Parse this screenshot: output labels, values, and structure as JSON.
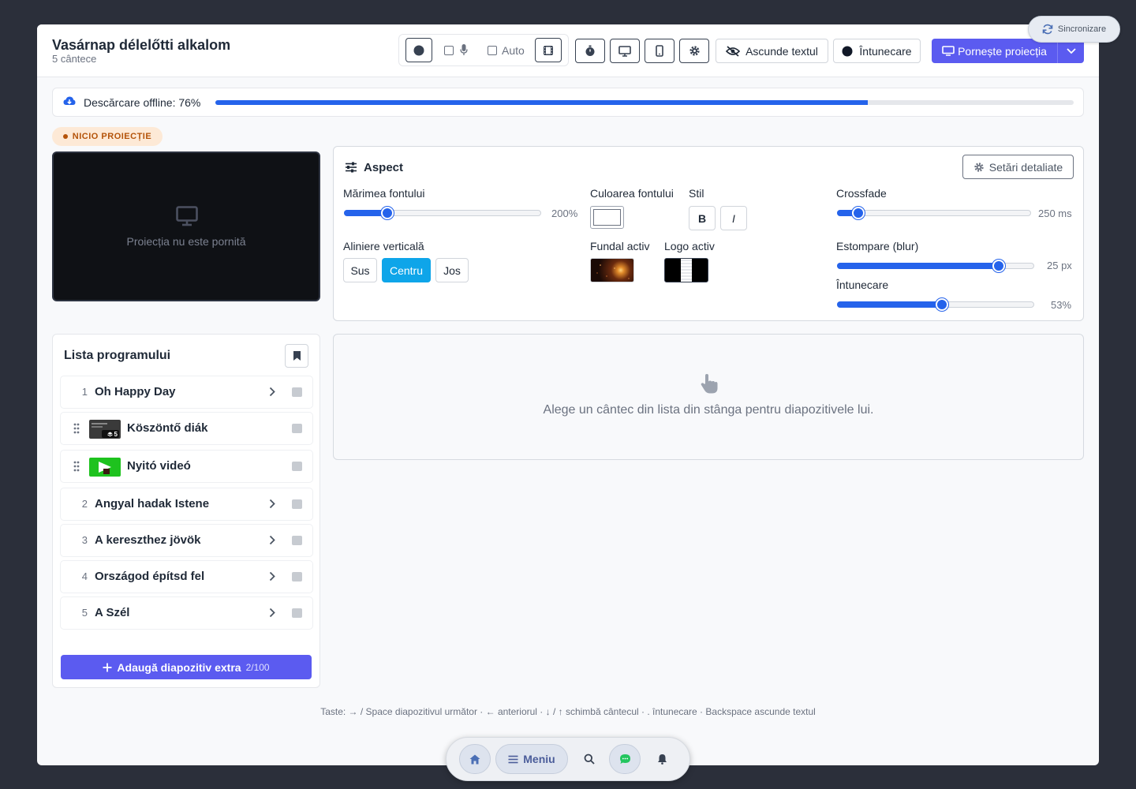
{
  "header": {
    "title": "Vasárnap délelőtti alkalom",
    "subtitle": "5 cântece",
    "auto_label": "Auto",
    "hide_text_label": "Ascunde textul",
    "darken_label": "Întunecare",
    "start_projection_label": "Pornește proiecția"
  },
  "sync": {
    "label": "Sincronizare"
  },
  "download": {
    "label": "Descărcare offline: 76%",
    "progress": 0.76
  },
  "projection": {
    "status_badge": "NICIO PROIECȚIE",
    "preview_text": "Proiecția nu este pornită"
  },
  "aspect": {
    "title": "Aspect",
    "detailed_settings_label": "Setări detaliate",
    "font_size": {
      "label": "Mărimea fontului",
      "value": "200%",
      "level": 0.22
    },
    "font_color": {
      "label": "Culoarea fontului",
      "color": "#ffffff"
    },
    "style": {
      "label": "Stil",
      "bold": "B",
      "italic": "I"
    },
    "crossfade": {
      "label": "Crossfade",
      "value": "250 ms",
      "level": 0.11
    },
    "vertical_align": {
      "label": "Aliniere verticală",
      "options": [
        "Sus",
        "Centru",
        "Jos"
      ],
      "selected": "Centru"
    },
    "background": {
      "label": "Fundal activ"
    },
    "logo": {
      "label": "Logo activ"
    },
    "blur": {
      "label": "Estompare (blur)",
      "value": "25 px",
      "level": 0.82
    },
    "dim": {
      "label": "Întunecare",
      "value": "53%",
      "level": 0.53
    }
  },
  "program": {
    "title": "Lista programului",
    "items": [
      {
        "num": "1",
        "name": "Oh Happy Day",
        "type": "song"
      },
      {
        "num": "",
        "name": "Köszöntő diák",
        "type": "slides",
        "badge": "5"
      },
      {
        "num": "",
        "name": "Nyitó videó",
        "type": "video"
      },
      {
        "num": "2",
        "name": "Angyal hadak Istene",
        "type": "song"
      },
      {
        "num": "3",
        "name": "A kereszthez jövök",
        "type": "song"
      },
      {
        "num": "4",
        "name": "Országod építsd fel",
        "type": "song"
      },
      {
        "num": "5",
        "name": "A Szél",
        "type": "song"
      }
    ],
    "add_label": "Adaugă diapozitiv extra",
    "add_count": "2/100"
  },
  "empty_state": {
    "text": "Alege un cântec din lista din stânga pentru diapozitivele lui."
  },
  "shortcuts": {
    "text": "Taste: → / Space diapozitivul următor · ← anteriorul · ↓ / ↑ schimbă cântecul · . întunecare · Backspace ascunde textul"
  },
  "dock": {
    "menu_label": "Meniu"
  },
  "colors": {
    "accent": "#5b5bf0",
    "progress": "#2563eb",
    "active_segment": "#0ea5e9"
  }
}
